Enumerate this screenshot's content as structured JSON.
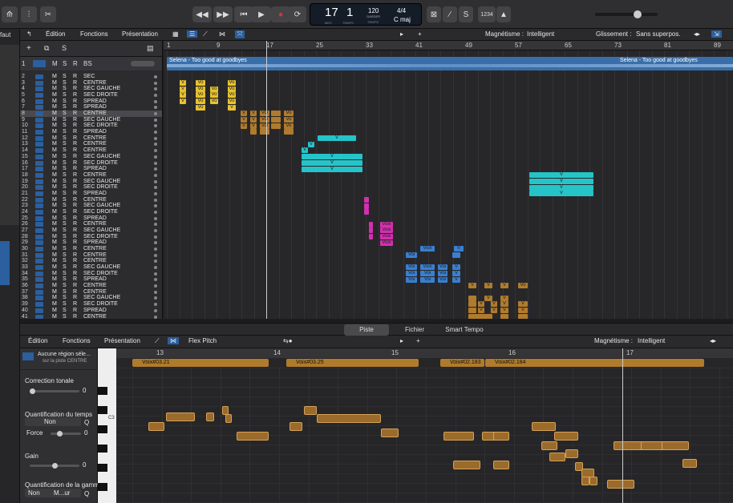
{
  "control_bar": {
    "lcd_bars": "17",
    "lcd_beat": "1",
    "lcd_label_bars": "MES",
    "lcd_label_beat": "TEMPS",
    "tempo_value": "120",
    "tempo_label1": "GARDER",
    "tempo_label2": "TEMPO",
    "time_signature": "4/4",
    "key": "C maj",
    "count_in": "1234",
    "inspector_label": "faut"
  },
  "tracks_toolbar": {
    "menu_edit": "Édition",
    "menu_functions": "Fonctions",
    "menu_view": "Présentation",
    "snap_label": "Magnétisme :",
    "snap_value": "Intelligent",
    "drag_label": "Glissement :",
    "drag_value": "Sans superpos."
  },
  "master_track": {
    "num": "1",
    "m": "M",
    "s": "S",
    "r": "R",
    "name": "BS"
  },
  "tracks": [
    {
      "n": "2",
      "name": "SEC"
    },
    {
      "n": "3",
      "name": "CENTRE"
    },
    {
      "n": "4",
      "name": "SEC GAUCHE"
    },
    {
      "n": "5",
      "name": "SEC DROITE"
    },
    {
      "n": "6",
      "name": "SPREAD"
    },
    {
      "n": "7",
      "name": "SPREAD"
    },
    {
      "n": "8",
      "name": "CENTRE"
    },
    {
      "n": "9",
      "name": "SEC GAUCHE"
    },
    {
      "n": "10",
      "name": "SEC DROITE"
    },
    {
      "n": "11",
      "name": "SPREAD"
    },
    {
      "n": "12",
      "name": "CENTRE"
    },
    {
      "n": "13",
      "name": "CENTRE"
    },
    {
      "n": "14",
      "name": "CENTRE"
    },
    {
      "n": "15",
      "name": "SEC GAUCHE"
    },
    {
      "n": "16",
      "name": "SEC DROITE"
    },
    {
      "n": "17",
      "name": "SPREAD"
    },
    {
      "n": "18",
      "name": "CENTRE"
    },
    {
      "n": "19",
      "name": "SEC GAUCHE"
    },
    {
      "n": "20",
      "name": "SEC DROITE"
    },
    {
      "n": "21",
      "name": "SPREAD"
    },
    {
      "n": "22",
      "name": "CENTRE"
    },
    {
      "n": "23",
      "name": "SEC GAUCHE"
    },
    {
      "n": "24",
      "name": "SEC DROITE"
    },
    {
      "n": "25",
      "name": "SPREAD"
    },
    {
      "n": "26",
      "name": "CENTRE"
    },
    {
      "n": "27",
      "name": "SEC GAUCHE"
    },
    {
      "n": "28",
      "name": "SEC DROITE"
    },
    {
      "n": "29",
      "name": "SPREAD"
    },
    {
      "n": "30",
      "name": "CENTRE"
    },
    {
      "n": "31",
      "name": "CENTRE"
    },
    {
      "n": "32",
      "name": "CENTRE"
    },
    {
      "n": "33",
      "name": "SEC GAUCHE"
    },
    {
      "n": "34",
      "name": "SEC DROITE"
    },
    {
      "n": "35",
      "name": "SPREAD"
    },
    {
      "n": "36",
      "name": "CENTRE"
    },
    {
      "n": "37",
      "name": "CENTRE"
    },
    {
      "n": "38",
      "name": "SEC GAUCHE"
    },
    {
      "n": "39",
      "name": "SEC DROITE"
    },
    {
      "n": "40",
      "name": "SPREAD"
    },
    {
      "n": "41",
      "name": "CENTRE"
    }
  ],
  "track_letters": {
    "m": "M",
    "s": "S",
    "r": "R"
  },
  "ruler_bars": [
    "1",
    "9",
    "17",
    "25",
    "33",
    "41",
    "49",
    "57",
    "65",
    "73",
    "81",
    "89"
  ],
  "master_region_label": "Selena - Too good at goodbyes",
  "master_region_label2": "Selena - Too good at goodbyes",
  "region_labels": {
    "v": "V",
    "vo": "Vo",
    "voi": "Voi",
    "voix": "Voix"
  },
  "tabs": {
    "track": "Piste",
    "file": "Fichier",
    "smart_tempo": "Smart Tempo"
  },
  "editor_toolbar": {
    "menu_edit": "Édition",
    "menu_functions": "Fonctions",
    "menu_view": "Présentation",
    "mode": "Flex Pitch",
    "snap_label": "Magnétisme :",
    "snap_value": "Intelligent"
  },
  "editor_left": {
    "region_title": "Aucune région séle...",
    "region_sub": "sur la piste CENTRE",
    "pitch_correction": "Correction tonale",
    "pitch_value": "0",
    "quantize_label": "Quantification du temps",
    "quantize_value": "Non",
    "q_letter": "Q",
    "force_label": "Force",
    "force_value": "0",
    "gain_label": "Gain",
    "gain_value": "0",
    "scale_label": "Quantification de la gamme",
    "scale_value": "Non",
    "scale_value2": "M...ur"
  },
  "piano_c3": "C3",
  "editor_ruler": [
    "13",
    "14",
    "15",
    "16",
    "17"
  ],
  "editor_regions": [
    "Voix#03.21",
    "Voix#03.25",
    "Voix#02.183",
    "Voix#02.184"
  ],
  "colors": {
    "yellow": "#e8c22e",
    "orange": "#b07b2c",
    "cyan": "#25c4c9",
    "magenta": "#d42fb0",
    "blue": "#3a7fd0",
    "master": "#3a6ea8"
  }
}
